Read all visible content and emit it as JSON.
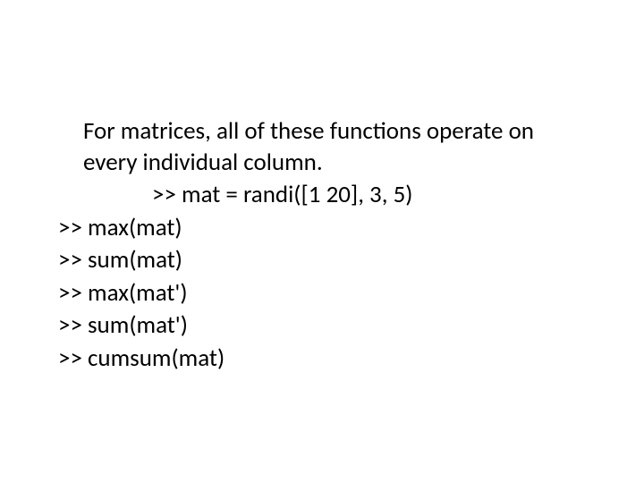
{
  "intro": "For matrices, all of these functions operate on every individual column.",
  "indentedCmd": ">>  mat   =  randi([1 20], 3, 5)",
  "cmds": [
    ">>  max(mat)",
    ">>  sum(mat)",
    ">>  max(mat')",
    ">>  sum(mat')",
    ">>  cumsum(mat)"
  ]
}
